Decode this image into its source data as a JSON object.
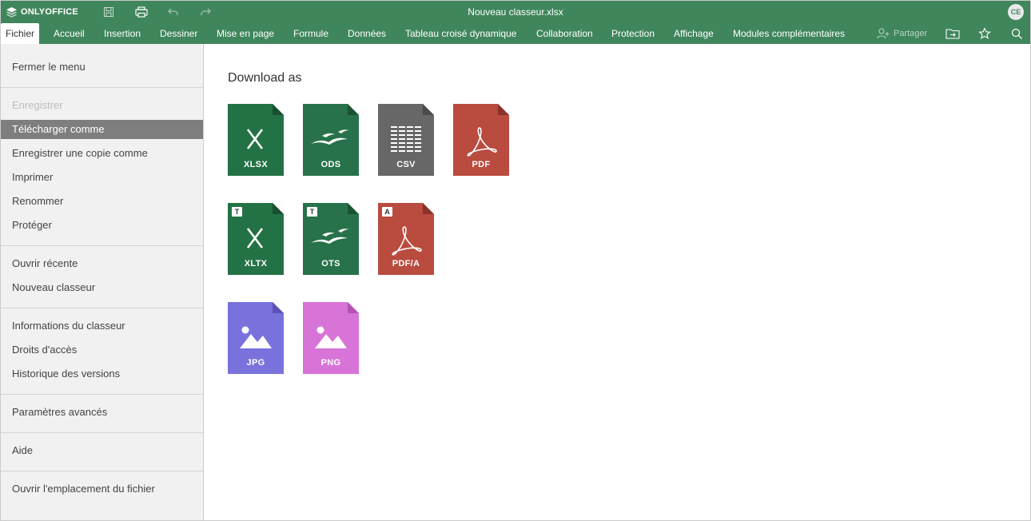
{
  "app": {
    "brand": "ONLYOFFICE",
    "document_title": "Nouveau classeur.xlsx",
    "user_initials": "CE",
    "colors": {
      "header": "#40865c",
      "menu_bg": "#f1f1f1",
      "selected": "#7e7e7e"
    }
  },
  "quick_access": [
    {
      "name": "save-icon"
    },
    {
      "name": "print-icon"
    },
    {
      "name": "undo-icon"
    },
    {
      "name": "redo-icon"
    }
  ],
  "tabs": [
    {
      "label": "Fichier",
      "active": true
    },
    {
      "label": "Accueil"
    },
    {
      "label": "Insertion"
    },
    {
      "label": "Dessiner"
    },
    {
      "label": "Mise en page"
    },
    {
      "label": "Formule"
    },
    {
      "label": "Données"
    },
    {
      "label": "Tableau croisé dynamique"
    },
    {
      "label": "Collaboration"
    },
    {
      "label": "Protection"
    },
    {
      "label": "Affichage"
    },
    {
      "label": "Modules complémentaires"
    }
  ],
  "toolbar_right": {
    "share_label": "Partager",
    "icons": [
      "open-location-icon",
      "favorite-star-icon",
      "search-icon"
    ]
  },
  "menu": {
    "items": [
      {
        "label": "Fermer le menu"
      },
      {
        "label": "Enregistrer",
        "disabled": true
      },
      {
        "label": "Télécharger comme",
        "selected": true
      },
      {
        "label": "Enregistrer une copie comme"
      },
      {
        "label": "Imprimer"
      },
      {
        "label": "Renommer"
      },
      {
        "label": "Protéger"
      },
      {
        "label": "Ouvrir récente"
      },
      {
        "label": "Nouveau classeur"
      },
      {
        "label": "Informations du classeur"
      },
      {
        "label": "Droits d'accès"
      },
      {
        "label": "Historique des versions"
      },
      {
        "label": "Paramètres avancés"
      },
      {
        "label": "Aide"
      },
      {
        "label": "Ouvrir l'emplacement du fichier"
      }
    ]
  },
  "download": {
    "title": "Download as",
    "formats": [
      {
        "label": "XLSX",
        "color": "#237246",
        "glyph": "x-icon"
      },
      {
        "label": "ODS",
        "color": "#27724a",
        "glyph": "seagull-icon"
      },
      {
        "label": "CSV",
        "color": "#676767",
        "glyph": "csv-grid-icon"
      },
      {
        "label": "PDF",
        "color": "#b94b3f",
        "glyph": "acrobat-icon"
      },
      {
        "label": "XLTX",
        "color": "#237246",
        "glyph": "x-icon",
        "badge": "T"
      },
      {
        "label": "OTS",
        "color": "#27724a",
        "glyph": "seagull-icon",
        "badge": "T"
      },
      {
        "label": "PDF/A",
        "color": "#b94b3f",
        "glyph": "acrobat-icon",
        "badge": "A"
      },
      {
        "label": "JPG",
        "color": "#7a72dc",
        "glyph": "image-icon"
      },
      {
        "label": "PNG",
        "color": "#d874d8",
        "glyph": "image-icon"
      }
    ]
  }
}
